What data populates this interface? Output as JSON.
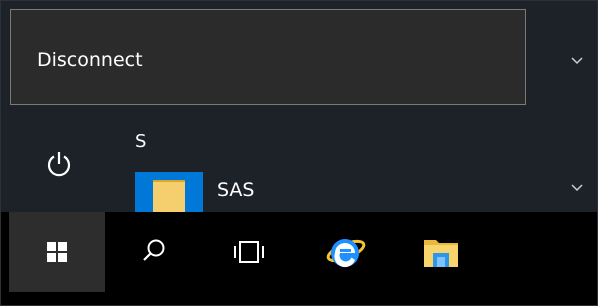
{
  "power_menu": {
    "disconnect_label": "Disconnect"
  },
  "app_list": {
    "section_letter": "S",
    "items": [
      {
        "label": "SAS",
        "icon": "folder-icon"
      }
    ]
  },
  "taskbar": {
    "buttons": [
      {
        "name": "start-button",
        "icon": "windows-logo-icon"
      },
      {
        "name": "search-button",
        "icon": "search-icon"
      },
      {
        "name": "task-view-button",
        "icon": "task-view-icon"
      },
      {
        "name": "internet-explorer-button",
        "icon": "internet-explorer-icon"
      },
      {
        "name": "file-explorer-button",
        "icon": "file-explorer-icon"
      }
    ]
  },
  "colors": {
    "panel_background": "#1d2128",
    "menu_background": "#2b2b2b",
    "menu_border": "#7a7a7a",
    "taskbar_background": "#000000",
    "active_taskbar_button": "#2d2d2d",
    "accent": "#0078d7",
    "folder": "#f5cf6e"
  }
}
